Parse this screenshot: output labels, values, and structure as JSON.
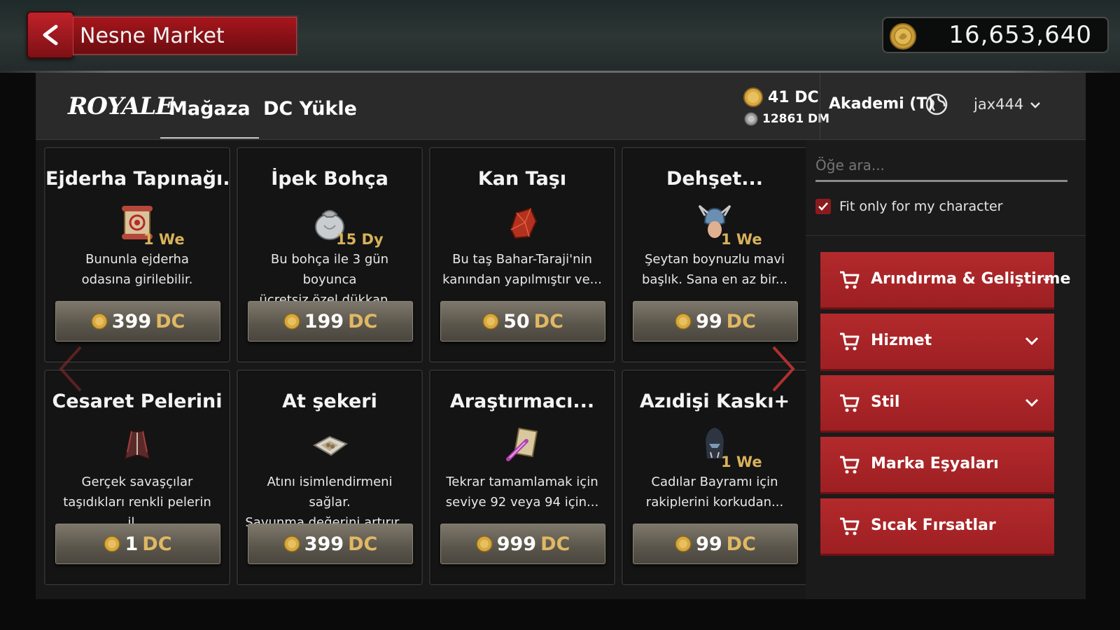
{
  "header_bar": {
    "title": "Nesne Market",
    "gold_amount": "16,653,640"
  },
  "store": {
    "logo_text": "ROYALE",
    "tabs": [
      {
        "label": "Mağaza",
        "active": true
      },
      {
        "label": "DC Yükle",
        "active": false
      }
    ],
    "dc_balance": "41 DC",
    "dm_balance": "12861 DM",
    "server": "Akademi (T)",
    "username": "jax444"
  },
  "items": [
    {
      "name": "Ejderha Tapınağı..",
      "duration": "1 We",
      "desc_line1": "Bununla ejderha",
      "desc_line2": "odasına girilebilir.",
      "price": "399",
      "unit": "DC",
      "icon": "scroll-icon"
    },
    {
      "name": "İpek Bohça",
      "duration": "15 Dy",
      "desc_line1": "Bu bohça ile 3 gün boyunca",
      "desc_line2": "ücretsiz özel dükkan...",
      "price": "199",
      "unit": "DC",
      "icon": "silk-bundle-icon"
    },
    {
      "name": "Kan Taşı",
      "duration": "",
      "desc_line1": "Bu taş Bahar-Taraji'nin",
      "desc_line2": "kanından yapılmıştır ve...",
      "price": "50",
      "unit": "DC",
      "icon": "blood-stone-icon"
    },
    {
      "name": "Dehşet...",
      "duration": "1 We",
      "desc_line1": "Şeytan boynuzlu mavi",
      "desc_line2": "başlık. Sana en az bir...",
      "price": "99",
      "unit": "DC",
      "icon": "horned-helmet-icon"
    },
    {
      "name": "Cesaret Pelerini",
      "duration": "",
      "desc_line1": "Gerçek savaşçılar",
      "desc_line2": "taşıdıkları renkli pelerin il...",
      "price": "1",
      "unit": "DC",
      "icon": "cape-icon"
    },
    {
      "name": "At şekeri",
      "duration": "",
      "desc_line1": "Atını isimlendirmeni sağlar.",
      "desc_line2": "Savunma değerini artırır....",
      "price": "399",
      "unit": "DC",
      "icon": "horse-candy-icon"
    },
    {
      "name": "Araştırmacı...",
      "duration": "",
      "desc_line1": "Tekrar tamamlamak için",
      "desc_line2": "seviye 92 veya 94 için...",
      "price": "999",
      "unit": "DC",
      "icon": "research-scroll-icon"
    },
    {
      "name": "Azıdişi Kaskı+",
      "duration": "1 We",
      "desc_line1": "Cadılar Bayramı için",
      "desc_line2": "rakiplerini korkudan...",
      "price": "99",
      "unit": "DC",
      "icon": "fang-helmet-icon"
    }
  ],
  "sidebar": {
    "search_placeholder": "Öğe ara...",
    "fit_label": "Fit only for my character",
    "fit_checked": true,
    "categories": [
      {
        "label": "Arındırma & Geliştirme",
        "has_dropdown": true
      },
      {
        "label": "Hizmet",
        "has_dropdown": true
      },
      {
        "label": "Stil",
        "has_dropdown": true
      },
      {
        "label": "Marka Eşyaları",
        "has_dropdown": false
      },
      {
        "label": "Sıcak Fırsatlar",
        "has_dropdown": false
      }
    ]
  },
  "colors": {
    "accent_red": "#a8161c",
    "price_gold": "#e0b864",
    "duration_gold": "#d8b25a"
  }
}
